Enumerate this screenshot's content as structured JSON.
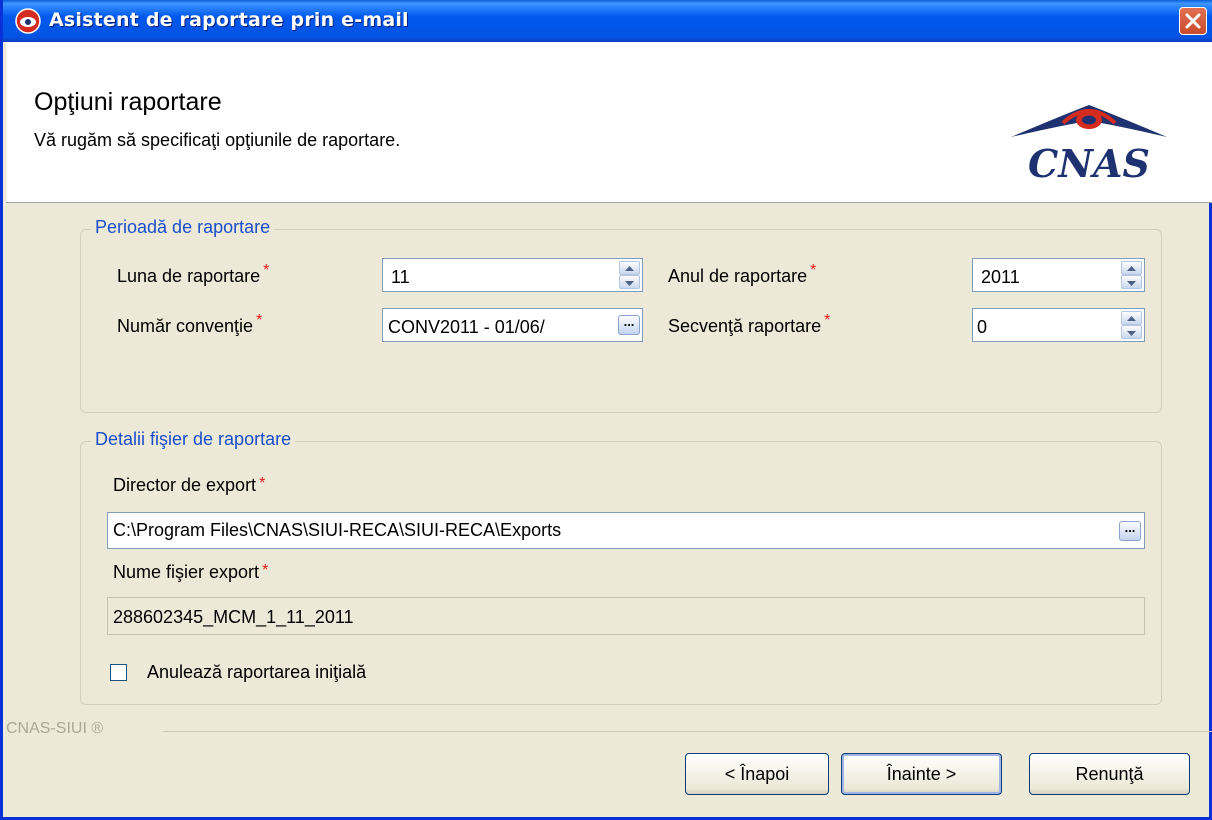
{
  "window": {
    "title": "Asistent de raportare prin e-mail"
  },
  "header": {
    "title": "Opţiuni raportare",
    "subtitle": "Vă rugăm să specificaţi opţiunile de raportare.",
    "logo_text": "CNAS"
  },
  "period_group": {
    "legend": "Perioadă de raportare",
    "month_label": "Luna de raportare",
    "month_value": "11",
    "year_label": "Anul de raportare",
    "year_value": "2011",
    "convention_label": "Număr convenţie",
    "convention_value": "CONV2011 - 01/06/",
    "sequence_label": "Secvenţă raportare",
    "sequence_value": "0",
    "required_mark": "*"
  },
  "file_group": {
    "legend": "Detalii fişier de raportare",
    "dir_label": "Director de export",
    "dir_value": "C:\\Program Files\\CNAS\\SIUI-RECA\\SIUI-RECA\\Exports",
    "name_label": "Nume fişier export",
    "name_value": "288602345_MCM_1_11_2011",
    "cancel_checkbox_label": "Anulează raportarea iniţială",
    "cancel_checked": false
  },
  "footer": {
    "brand": "CNAS-SIUI ®",
    "back_label": "< Înapoi",
    "next_label": "Înainte >",
    "cancel_label": "Renunţă"
  },
  "colors": {
    "titlebar": "#0058ee",
    "legend": "#1a4ecb",
    "required": "#e81a1a",
    "logo_navy": "#1e3170",
    "logo_red": "#d62b1f"
  }
}
